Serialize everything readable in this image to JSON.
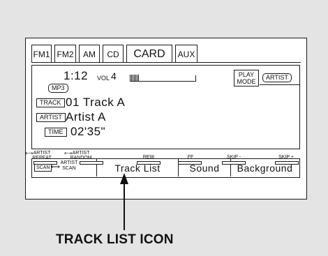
{
  "tabs": [
    "FM1",
    "FM2",
    "AM",
    "CD",
    "CARD",
    "AUX"
  ],
  "active_tab": "CARD",
  "display": {
    "clock": "1:12",
    "vol_label": "VOL",
    "vol_value": "4",
    "vol_level": 0.15,
    "format_label": "MP3",
    "play_mode_label": "PLAY\nMODE",
    "artist_button": "ARTIST",
    "track_label": "TRACK",
    "track_value": "01  Track  A",
    "artist_label": "ARTIST",
    "artist_value": "Artist  A",
    "time_label": "TIME",
    "time_value": "02'35\""
  },
  "soft_keys": {
    "scan": "SCAN",
    "artist_scan": "ARTIST\nSCAN",
    "track_list": "Track  List",
    "sound": "Sound",
    "background": "Background"
  },
  "function_keys": [
    "ARTIST\nREPEAT",
    "ARTIST\nRANDOM",
    "REW",
    "FF",
    "SKIP -",
    "SKIP +"
  ],
  "callout": "TRACK LIST ICON"
}
